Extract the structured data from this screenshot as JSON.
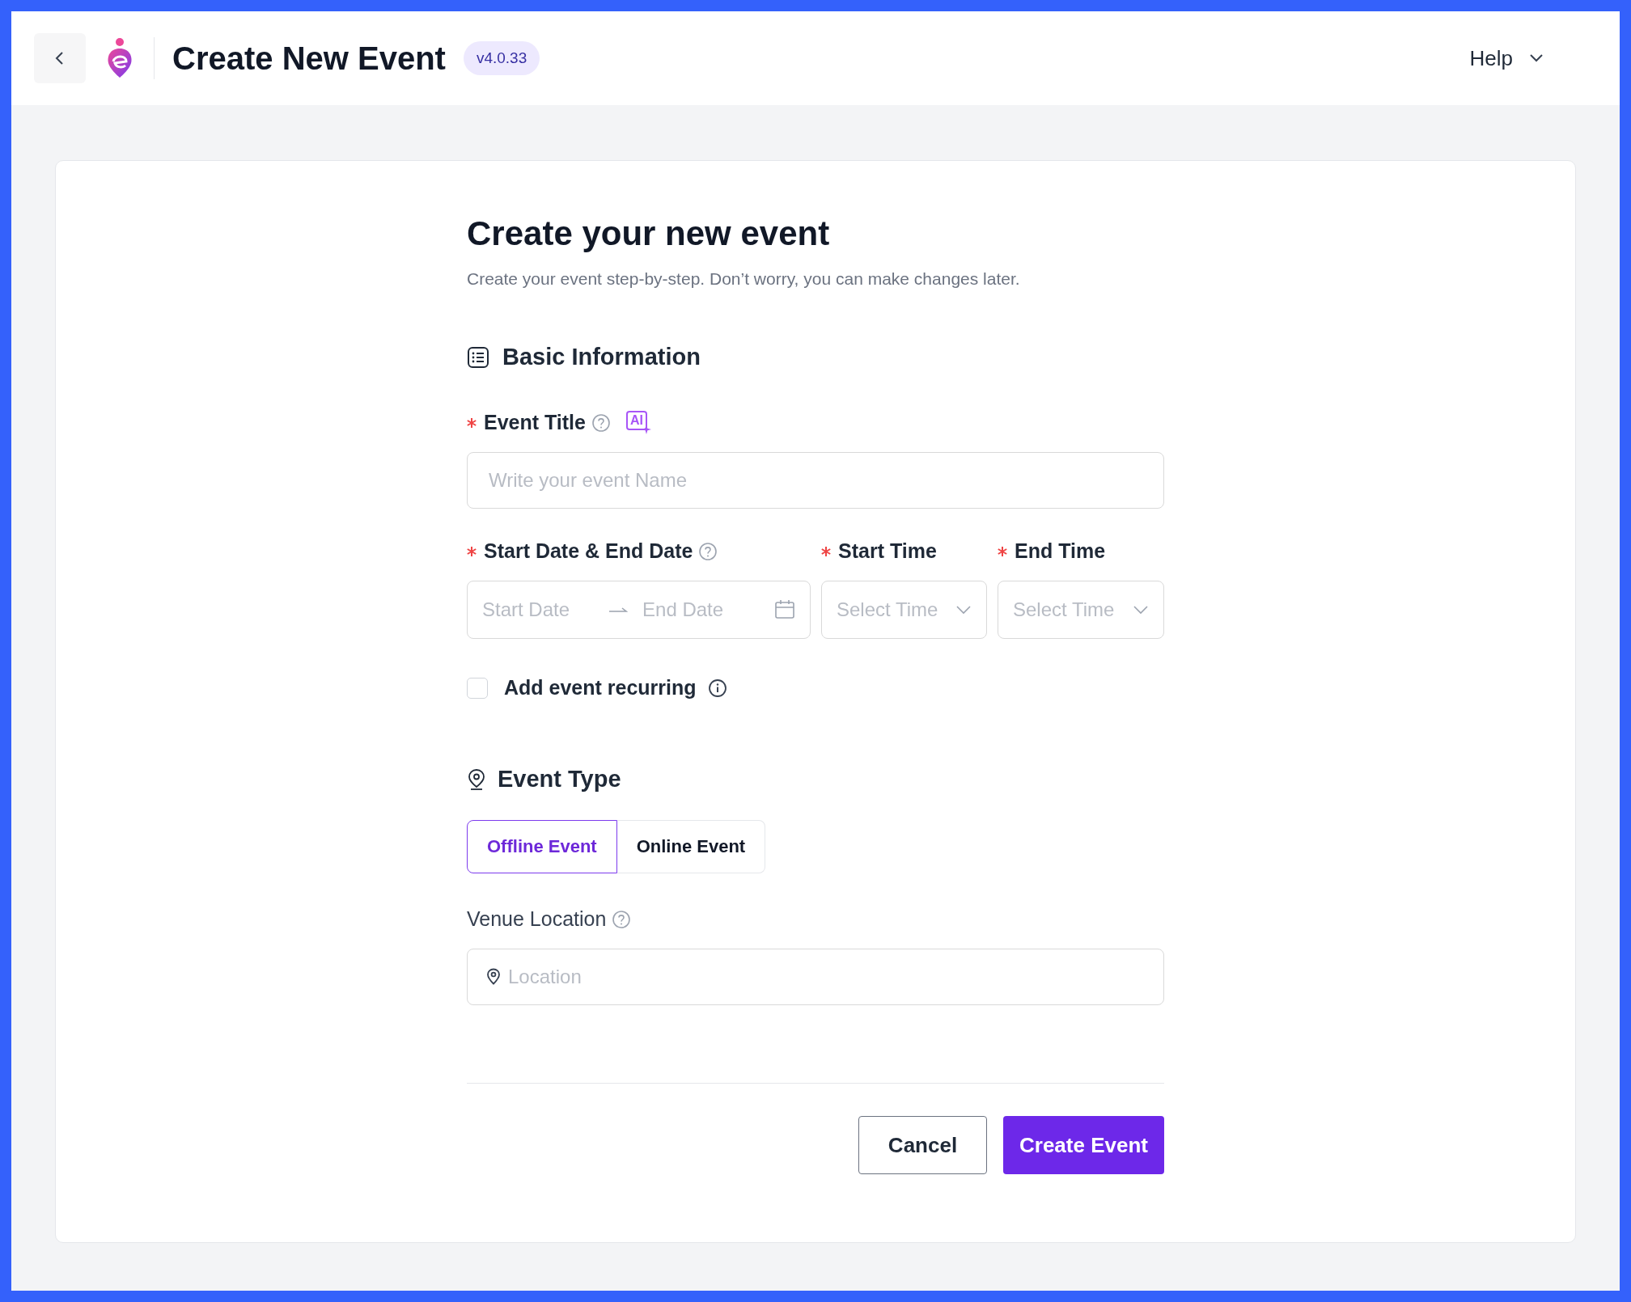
{
  "header": {
    "title": "Create New Event",
    "version": "v4.0.33",
    "help": "Help"
  },
  "form": {
    "heading": "Create your new event",
    "subtitle": "Create your event step-by-step. Don’t worry, you can make changes later.",
    "basic_section": {
      "title": "Basic Information"
    },
    "event_title": {
      "label": "Event Title",
      "required": true,
      "ai_badge": "AI",
      "placeholder": "Write your event Name"
    },
    "date_range": {
      "label": "Start Date & End Date",
      "required": true,
      "start_placeholder": "Start Date",
      "end_placeholder": "End Date"
    },
    "start_time": {
      "label": "Start Time",
      "required": true,
      "placeholder": "Select Time"
    },
    "end_time": {
      "label": "End Time",
      "required": true,
      "placeholder": "Select Time"
    },
    "recurring": {
      "label": "Add event recurring",
      "checked": false
    },
    "type_section": {
      "title": "Event Type"
    },
    "event_types": [
      {
        "label": "Offline Event",
        "selected": true
      },
      {
        "label": "Online Event",
        "selected": false
      }
    ],
    "venue": {
      "label": "Venue Location",
      "placeholder": "Location"
    },
    "buttons": [
      {
        "label": "Cancel",
        "kind": "secondary"
      },
      {
        "label": "Create Event",
        "kind": "primary"
      }
    ]
  }
}
